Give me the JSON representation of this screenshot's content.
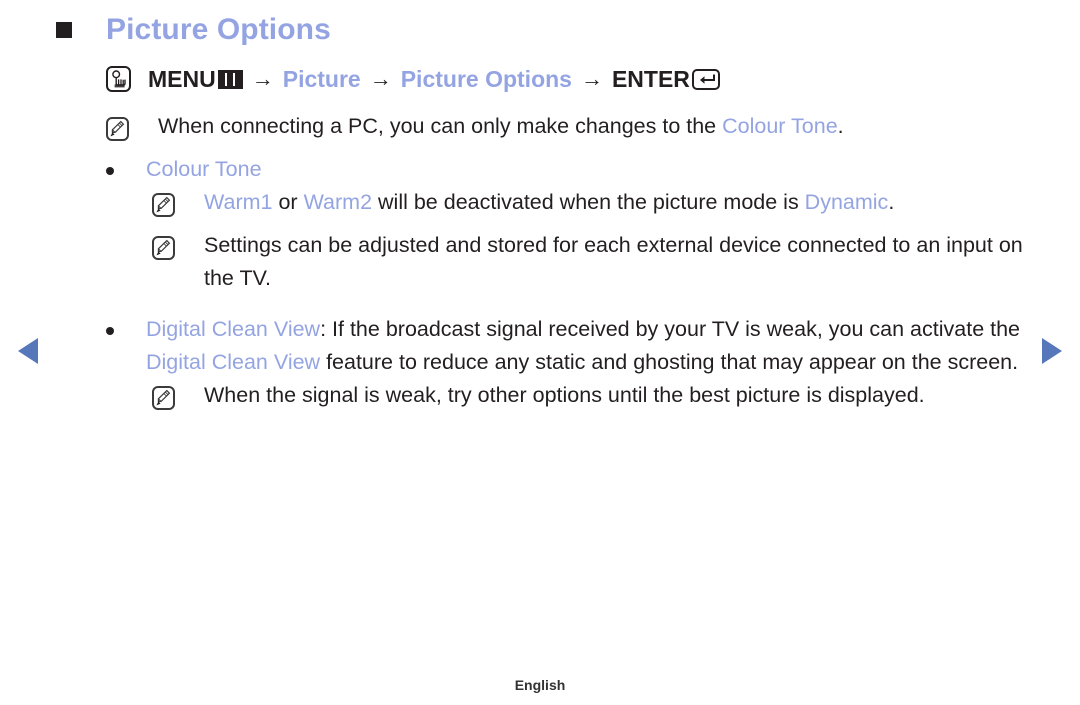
{
  "page": {
    "title": "Picture Options",
    "footer_language": "English",
    "accent_color": "#94a4e2",
    "text_color": "#231f20",
    "arrow_color": "#5777bb"
  },
  "nav": {
    "prev_label": "◀",
    "next_label": "▶"
  },
  "menu_path": {
    "touch_icon": "touch-hand-icon",
    "menu_label": "MENU",
    "menu_icon": "menu-grid-icon",
    "arrow": "→",
    "step1": "Picture",
    "step2": "Picture Options",
    "enter_label": "ENTER",
    "enter_icon": "enter-key-icon"
  },
  "blocks": [
    {
      "type": "note",
      "icon": "note-pencil-icon",
      "parts": [
        {
          "text": "When connecting a PC, you can only make changes to the ",
          "accent": false
        },
        {
          "text": "Colour Tone",
          "accent": true
        },
        {
          "text": ".",
          "accent": false
        }
      ]
    },
    {
      "type": "bullet",
      "parts": [
        {
          "text": "Colour Tone",
          "accent": true
        }
      ]
    },
    {
      "type": "subnote",
      "icon": "note-pencil-icon",
      "parts": [
        {
          "text": "Warm1",
          "accent": true
        },
        {
          "text": " or ",
          "accent": false
        },
        {
          "text": "Warm2",
          "accent": true
        },
        {
          "text": " will be deactivated when the picture mode is ",
          "accent": false
        },
        {
          "text": "Dynamic",
          "accent": true
        },
        {
          "text": ".",
          "accent": false
        }
      ]
    },
    {
      "type": "subnote",
      "icon": "note-pencil-icon",
      "parts": [
        {
          "text": "Settings can be adjusted and stored for each external device connected to an input on the TV.",
          "accent": false
        }
      ]
    },
    {
      "type": "bullet",
      "parts": [
        {
          "text": "Digital Clean View",
          "accent": true
        },
        {
          "text": ": If the broadcast signal received by your TV is weak, you can activate the ",
          "accent": false
        },
        {
          "text": "Digital Clean View",
          "accent": true
        },
        {
          "text": " feature to reduce any static and ghosting that may appear on the screen.",
          "accent": false
        }
      ]
    },
    {
      "type": "subnote",
      "icon": "note-pencil-icon",
      "parts": [
        {
          "text": "When the signal is weak, try other options until the best picture is displayed.",
          "accent": false
        }
      ]
    }
  ]
}
